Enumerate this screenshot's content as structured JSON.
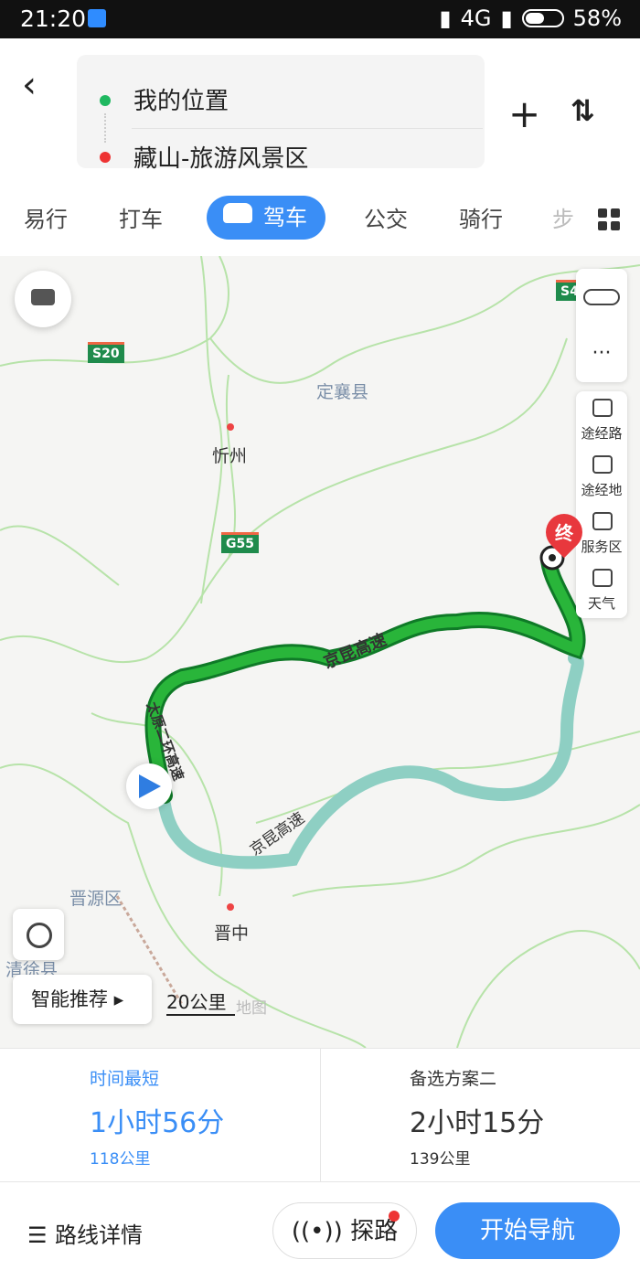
{
  "statusbar": {
    "time": "21:20",
    "network": "4G",
    "battery": "58%"
  },
  "search": {
    "origin": "我的位置",
    "destination": "藏山-旅游风景区"
  },
  "tabs": [
    {
      "label": "易行"
    },
    {
      "label": "打车"
    },
    {
      "label": "驾车"
    },
    {
      "label": "公交"
    },
    {
      "label": "骑行"
    },
    {
      "label": "步"
    }
  ],
  "map": {
    "labels": {
      "dingxiang": "定襄县",
      "xinzhou": "忻州",
      "jinyuan": "晋源区",
      "jinzhong": "晋中",
      "qingxu": "清徐县"
    },
    "shields": {
      "s20": "S20",
      "g55": "G55",
      "s4": "S4"
    },
    "route_names": {
      "main": "京昆高速",
      "alt": "京昆高速",
      "ring": "太原二环高速"
    },
    "end_marker": "终",
    "scale": "20公里",
    "watermark": "地图"
  },
  "right_panel": {
    "waypoints": "途经路",
    "via_place": "途经地",
    "service": "服务区",
    "weather": "天气"
  },
  "smart_recommend": "智能推荐 ▸",
  "routes": [
    {
      "tag": "时间最短",
      "time": "1小时56分",
      "distance": "118公里"
    },
    {
      "tag": "备选方案二",
      "time": "2小时15分",
      "distance": "139公里"
    }
  ],
  "bottom": {
    "details": "路线详情",
    "explore": "探路",
    "start": "开始导航"
  },
  "colors": {
    "accent": "#3a8ef6",
    "route_main": "#1aa33a",
    "route_alt": "#8ecfc3"
  }
}
